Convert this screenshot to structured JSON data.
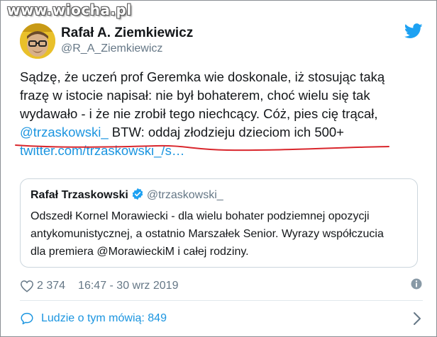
{
  "watermark": "www.wiocha.pl",
  "colors": {
    "link": "#1b95e0",
    "text": "#14171a",
    "muted": "#657786",
    "twitter_blue": "#1da1f2",
    "underline": "#d9262c",
    "avatar_bg": "#e9c02a"
  },
  "author": {
    "name": "Rafał A. Ziemkiewicz",
    "handle": "@R_A_Ziemkiewicz"
  },
  "tweet": {
    "line1": "Sądzę, że uczeń prof Geremka wie doskonale, iż stosując taką",
    "line2": "frazę w istocie napisał: nie był bohaterem, choć wielu się tak",
    "line3": "wydawało - i że nie zrobił tego niechcący. Cóż, pies cię trącał,",
    "mention": "@trzaskowski_",
    "line4_rest": " BTW: oddaj złodzieju dzieciom ich 500+",
    "url": "twitter.com/trzaskowski_/s…"
  },
  "quoted": {
    "name": "Rafał Trzaskowski",
    "handle": "@trzaskowski_",
    "line1": "Odszedł Kornel Morawiecki - dla wielu bohater podziemnej opozycji",
    "line2": "antykomunistycznej, a ostatnio Marszałek Senior. Wyrazy współczucia",
    "line3_pre": "dla premiera ",
    "line3_mention": "@MorawieckiM",
    "line3_post": " i całej rodziny."
  },
  "stats": {
    "likes": "2 374",
    "timestamp": "16:47 - 30 wrz 2019"
  },
  "people_talking": "Ludzie o tym mówią: 849",
  "icons": {
    "logo": "twitter-bird-icon",
    "verified": "verified-badge-icon",
    "like": "heart-icon",
    "info": "info-icon",
    "conversation": "speech-bubble-icon",
    "more": "chevron-right-icon"
  }
}
